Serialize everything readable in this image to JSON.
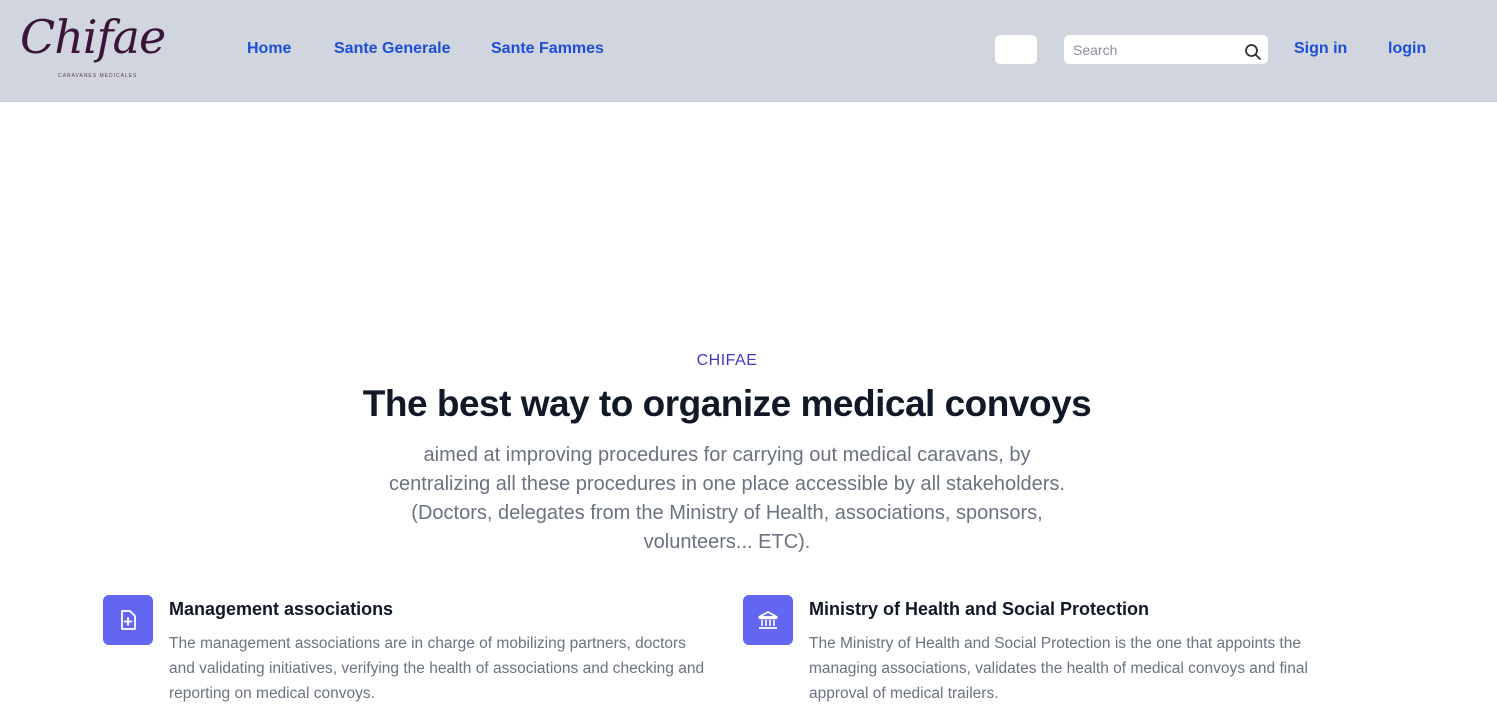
{
  "header": {
    "logo_text": "Chifae",
    "logo_tagline": "CARAVANES MEDICALES",
    "nav": [
      {
        "label": "Home"
      },
      {
        "label": "Sante Generale"
      },
      {
        "label": "Sante Fammes"
      }
    ],
    "search": {
      "placeholder": "Search",
      "value": ""
    },
    "auth": {
      "signin_label": "Sign in",
      "login_label": "login"
    }
  },
  "hero": {
    "eyebrow": "CHIFAE",
    "title": "The best way to organize medical convoys",
    "subtitle": "aimed at improving procedures for carrying out medical caravans, by centralizing all these procedures in one place accessible by all stakeholders. (Doctors, delegates from the Ministry of Health, associations, sponsors, volunteers... ETC)."
  },
  "features": [
    {
      "icon": "document-plus-icon",
      "title": "Management associations",
      "text": "The management associations are in charge of mobilizing partners, doctors and validating initiatives, verifying the health of associations and checking and reporting on medical convoys."
    },
    {
      "icon": "bank-building-icon",
      "title": "Ministry of Health and Social Protection",
      "text": "The Ministry of Health and Social Protection is the one that appoints the managing associations, validates the health of medical convoys and final approval of medical trailers."
    }
  ],
  "colors": {
    "navbar_bg": "#d1d5de",
    "link": "#1d4ed8",
    "accent": "#6366f1",
    "eyebrow": "#4338ca",
    "heading": "#111827",
    "body_text": "#6b7280"
  }
}
